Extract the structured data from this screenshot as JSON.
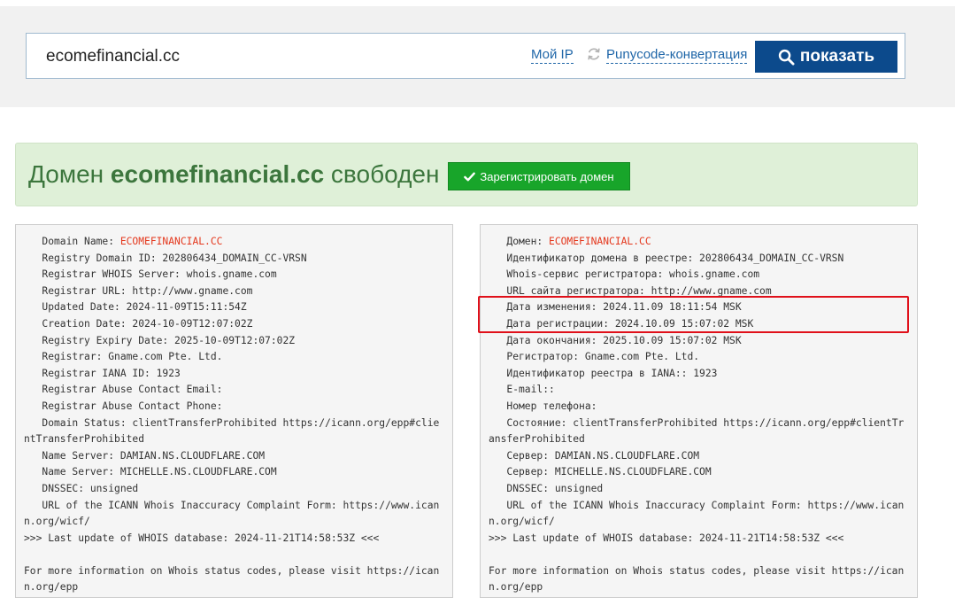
{
  "search": {
    "domain_value": "ecomefinancial.cc",
    "my_ip_label": "Мой IP",
    "punycode_label": "Punycode-конвертация",
    "show_button_label": "показать"
  },
  "alert": {
    "prefix": "Домен ",
    "domain": "ecomefinancial.cc",
    "suffix": " свободен",
    "register_button_label": "Зарегистрировать домен",
    "background_color": "#dff0d8",
    "text_color": "#3c763d",
    "button_color": "#18a52a"
  },
  "whois_en": {
    "lines": [
      {
        "label": "   Domain Name: ",
        "value": "ECOMEFINANCIAL.CC",
        "highlight": true
      },
      {
        "label": "   Registry Domain ID: 202806434_DOMAIN_CC-VRSN"
      },
      {
        "label": "   Registrar WHOIS Server: whois.gname.com"
      },
      {
        "label": "   Registrar URL: http://www.gname.com"
      },
      {
        "label": "   Updated Date: 2024-11-09T15:11:54Z"
      },
      {
        "label": "   Creation Date: 2024-10-09T12:07:02Z"
      },
      {
        "label": "   Registry Expiry Date: 2025-10-09T12:07:02Z"
      },
      {
        "label": "   Registrar: Gname.com Pte. Ltd."
      },
      {
        "label": "   Registrar IANA ID: 1923"
      },
      {
        "label": "   Registrar Abuse Contact Email:"
      },
      {
        "label": "   Registrar Abuse Contact Phone:"
      },
      {
        "label": "   Domain Status: clientTransferProhibited https://icann.org/epp#clientTransferProhibited"
      },
      {
        "label": "   Name Server: DAMIAN.NS.CLOUDFLARE.COM"
      },
      {
        "label": "   Name Server: MICHELLE.NS.CLOUDFLARE.COM"
      },
      {
        "label": "   DNSSEC: unsigned"
      },
      {
        "label": "   URL of the ICANN Whois Inaccuracy Complaint Form: https://www.icann.org/wicf/"
      },
      {
        "label": ">>> Last update of WHOIS database: 2024-11-21T14:58:53Z <<<"
      },
      {
        "label": " "
      },
      {
        "label": "For more information on Whois status codes, please visit https://icann.org/epp"
      }
    ]
  },
  "whois_ru": {
    "lines": [
      {
        "label": "   Домен: ",
        "value": "ECOMEFINANCIAL.CC",
        "highlight": true
      },
      {
        "label": "   Идентификатор домена в реестре: 202806434_DOMAIN_CC-VRSN"
      },
      {
        "label": "   Whois-сервис регистратора: whois.gname.com"
      },
      {
        "label": "   URL сайта регистратора: http://www.gname.com"
      },
      {
        "label": "   Дата изменения: 2024.11.09 18:11:54 MSK"
      },
      {
        "label": "   Дата регистрации: 2024.10.09 15:07:02 MSK"
      },
      {
        "label": "   Дата окончания: 2025.10.09 15:07:02 MSK"
      },
      {
        "label": "   Регистратор: Gname.com Pte. Ltd."
      },
      {
        "label": "   Идентификатор реестра в IANA:: 1923"
      },
      {
        "label": "   E-mail::"
      },
      {
        "label": "   Номер телефона:"
      },
      {
        "label": "   Состояние: clientTransferProhibited https://icann.org/epp#clientTransferProhibited"
      },
      {
        "label": "   Сервер: DAMIAN.NS.CLOUDFLARE.COM"
      },
      {
        "label": "   Сервер: MICHELLE.NS.CLOUDFLARE.COM"
      },
      {
        "label": "   DNSSEC: unsigned"
      },
      {
        "label": "   URL of the ICANN Whois Inaccuracy Complaint Form: https://www.icann.org/wicf/"
      },
      {
        "label": ">>> Last update of WHOIS database: 2024-11-21T14:58:53Z <<<"
      },
      {
        "label": " "
      },
      {
        "label": "For more information on Whois status codes, please visit https://icann.org/epp"
      }
    ]
  },
  "colors": {
    "primary_button": "#0c4a8c",
    "link": "#1f66a8",
    "domain_highlight": "#e4381d",
    "annotation_box": "#e0101a"
  },
  "icons": {
    "search": "search-icon",
    "refresh": "refresh-icon",
    "check": "check-icon"
  }
}
